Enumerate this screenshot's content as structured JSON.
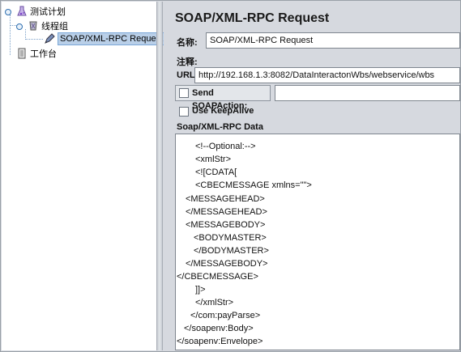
{
  "tree": {
    "root_label": "测试计划",
    "group_label": "线程组",
    "request_label": "SOAP/XML-RPC Request",
    "workbench_label": "工作台"
  },
  "panel": {
    "title": "SOAP/XML-RPC Request",
    "name_label": "名称:",
    "name_value": "SOAP/XML-RPC Request",
    "comment_label": "注释:",
    "comment_value": "",
    "url_label": "URL",
    "url_value": "http://192.168.1.3:8082/DataInteractonWbs/webservice/wbs",
    "send_soapaction_label": "Send SOAPAction:",
    "send_soapaction_checked": false,
    "soapaction_value": "",
    "keepalive_label": "Use KeepAlive",
    "keepalive_checked": false,
    "data_label": "Soap/XML-RPC Data"
  },
  "data_lines": [
    "<!--Optional:-->",
    "<xmlStr>",
    "<![CDATA[",
    "<CBECMESSAGE xmlns=\"\">",
    "<MESSAGEHEAD>",
    "</MESSAGEHEAD>",
    "<MESSAGEBODY>",
    "<BODYMASTER>",
    "</BODYMASTER>",
    "</MESSAGEBODY>",
    "</CBECMESSAGE>",
    "]]>",
    "</xmlStr>",
    "</com:payParse>",
    "</soapenv:Body>",
    "</soapenv:Envelope>"
  ],
  "colors": {
    "panel_bg": "#d6d9df",
    "selection_bg": "#b9cfe8"
  },
  "icons": {
    "root": "test-plan-icon",
    "group": "thread-group-icon",
    "request": "sampler-pen-icon",
    "workbench": "workbench-icon"
  }
}
